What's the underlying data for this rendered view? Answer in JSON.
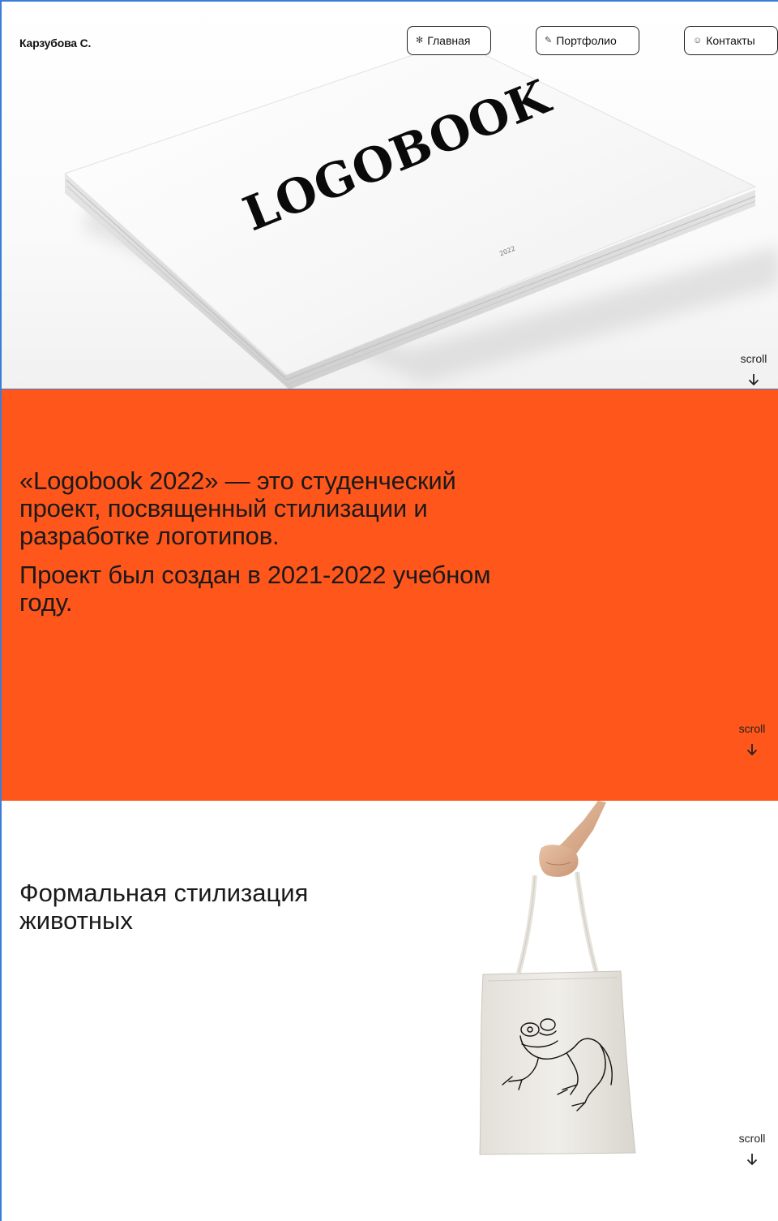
{
  "header": {
    "brand": "Карзубова С.",
    "nav": {
      "home": {
        "icon": "asterisk-icon",
        "label": "Главная"
      },
      "portfolio": {
        "icon": "pencil-icon",
        "label": "Портфолио"
      },
      "contacts": {
        "icon": "smile-icon",
        "label": "Контакты"
      }
    }
  },
  "hero": {
    "book_title": "LOGOBOOK",
    "book_year": "2022",
    "scroll_label": "scroll"
  },
  "about": {
    "paragraph_1": "«Logobook 2022» — это студенческий проект, посвященный стилизации и разработке логотипов.",
    "paragraph_2": "Проект был создан в 2021-2022 учебном году.",
    "scroll_label": "scroll",
    "background": "#ff561b"
  },
  "animals": {
    "title": "Формальная стилизация животных",
    "scroll_label": "scroll"
  }
}
